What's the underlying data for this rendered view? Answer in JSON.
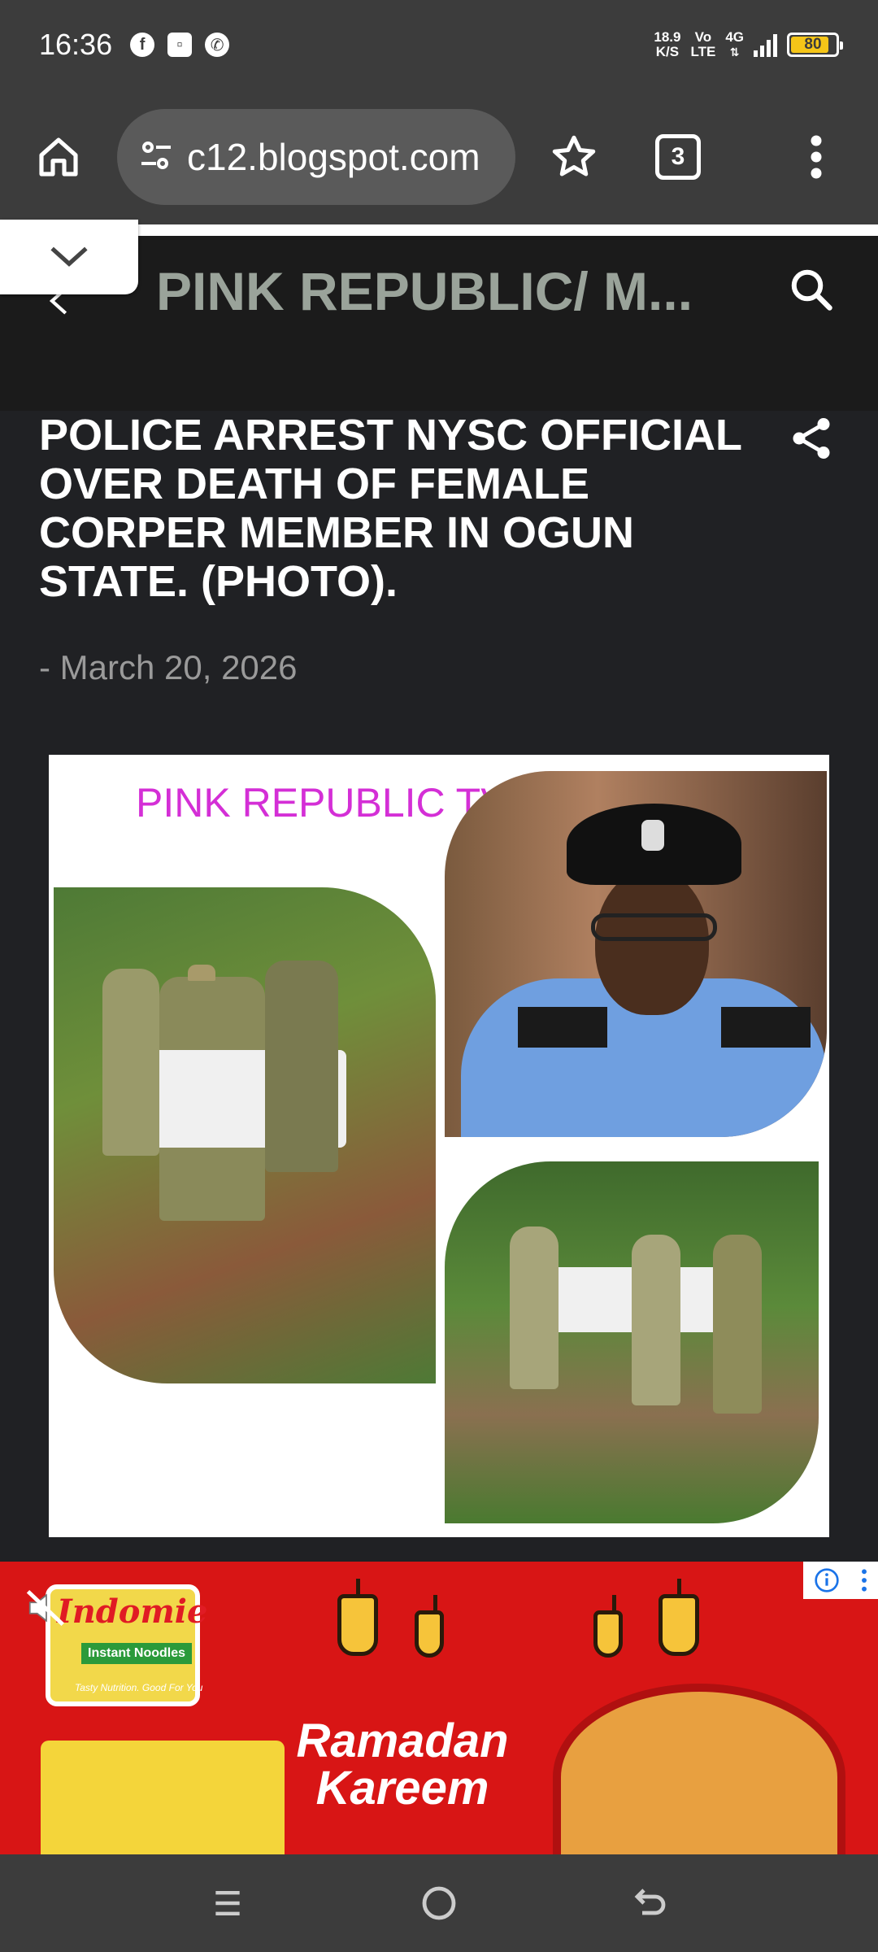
{
  "status_bar": {
    "time": "16:36",
    "net_speed_top": "18.9",
    "net_speed_unit": "K/S",
    "volte_top": "Vo",
    "volte_bottom": "LTE",
    "network": "4G",
    "battery_level": "80",
    "battery_color": "#f5c518",
    "icons": [
      "facebook-icon",
      "messenger-icon",
      "whatsapp-icon"
    ]
  },
  "toolbar": {
    "url": "c12.blogspot.com",
    "tab_count": "3"
  },
  "blog": {
    "title": "PINK REPUBLIC/ M..."
  },
  "article": {
    "title": "POLICE ARREST NYSC OFFICIAL OVER DEATH OF FEMALE CORPER MEMBER IN OGUN STATE. (PHOTO).",
    "date": "- March 20, 2026",
    "image_caption": "PINK REPUBLIC TV"
  },
  "ad": {
    "brand": "Indomie",
    "product_line": "Instant Noodles",
    "tagline": "Tasty Nutrition. Good For You",
    "headline_line1": "Ramadan",
    "headline_line2": "Kareem",
    "accent_color": "#d81515"
  }
}
